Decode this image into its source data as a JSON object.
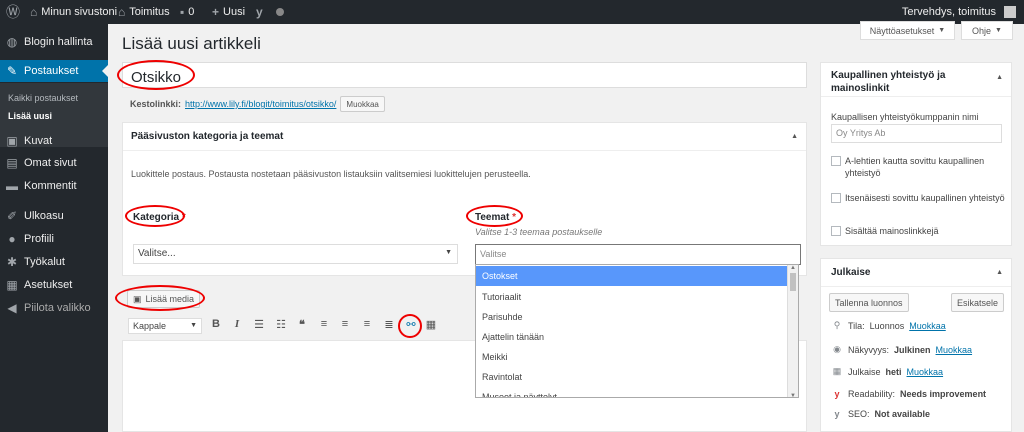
{
  "adminbar": {
    "site_name": "Minun sivustoni",
    "toimitus": "Toimitus",
    "comments_count": "0",
    "new_label": "Uusi",
    "greeting": "Tervehdys, toimitus"
  },
  "sidebar": {
    "items": [
      {
        "label": "Blogin hallinta",
        "icon": "dashboard-icon"
      },
      {
        "label": "Postaukset",
        "icon": "pin-icon"
      },
      {
        "label": "Kuvat",
        "icon": "media-icon"
      },
      {
        "label": "Omat sivut",
        "icon": "pages-icon"
      },
      {
        "label": "Kommentit",
        "icon": "comments-icon"
      },
      {
        "label": "Ulkoasu",
        "icon": "brush-icon"
      },
      {
        "label": "Profiili",
        "icon": "user-icon"
      },
      {
        "label": "Työkalut",
        "icon": "wrench-icon"
      },
      {
        "label": "Asetukset",
        "icon": "settings-icon"
      },
      {
        "label": "Piilota valikko",
        "icon": "collapse-icon"
      }
    ],
    "submenu": [
      "Kaikki postaukset",
      "Lisää uusi"
    ]
  },
  "page": {
    "title": "Lisää uusi artikkeli",
    "screen_options": "Näyttöasetukset",
    "help": "Ohje",
    "post_title": "Otsikko",
    "permalink_label": "Kestolinkki:",
    "permalink_url": "http://www.lily.fi/blogit/toimitus/otsikko/",
    "edit_button": "Muokkaa"
  },
  "category_box": {
    "title": "Pääsivuston kategoria ja teemat",
    "description": "Luokittele postaus. Postausta nostetaan pääsivuston listauksiin valitsemiesi luokittelujen perusteella.",
    "category_label": "Kategoria",
    "category_placeholder": "Valitse...",
    "themes_label": "Teemat",
    "themes_hint": "Valitse 1-3 teemaa postaukselle",
    "themes_placeholder": "Valitse",
    "required_mark": "*",
    "options": [
      "Ostokset",
      "Tutoriaalit",
      "Parisuhde",
      "Ajattelin tänään",
      "Meikki",
      "Ravintolat",
      "Museot ja näyttelyt"
    ]
  },
  "editor": {
    "add_media": "Lisää media",
    "format_select": "Kappale"
  },
  "commercial_box": {
    "title": "Kaupallinen yhteistyö ja mainoslinkit",
    "partner_label": "Kaupallisen yhteistyökumppanin nimi",
    "partner_placeholder": "Oy Yritys Ab",
    "checkboxes": [
      "A-lehtien kautta sovittu kaupallinen yhteistyö",
      "Itsenäisesti sovittu kaupallinen yhteistyö",
      "Sisältää mainoslinkkejä"
    ]
  },
  "publish_box": {
    "title": "Julkaise",
    "save_draft": "Tallenna luonnos",
    "preview": "Esikatsele",
    "status_label": "Tila:",
    "status_value": "Luonnos",
    "visibility_label": "Näkyvyys:",
    "visibility_value": "Julkinen",
    "publish_label": "Julkaise",
    "publish_value": "heti",
    "edit_link": "Muokkaa",
    "readability_label": "Readability:",
    "readability_value": "Needs improvement",
    "seo_label": "SEO:",
    "seo_value": "Not available"
  },
  "colors": {
    "accent": "#0073aa",
    "highlight": "#5897fb",
    "annotation": "#e00000",
    "required": "#dc3232"
  }
}
